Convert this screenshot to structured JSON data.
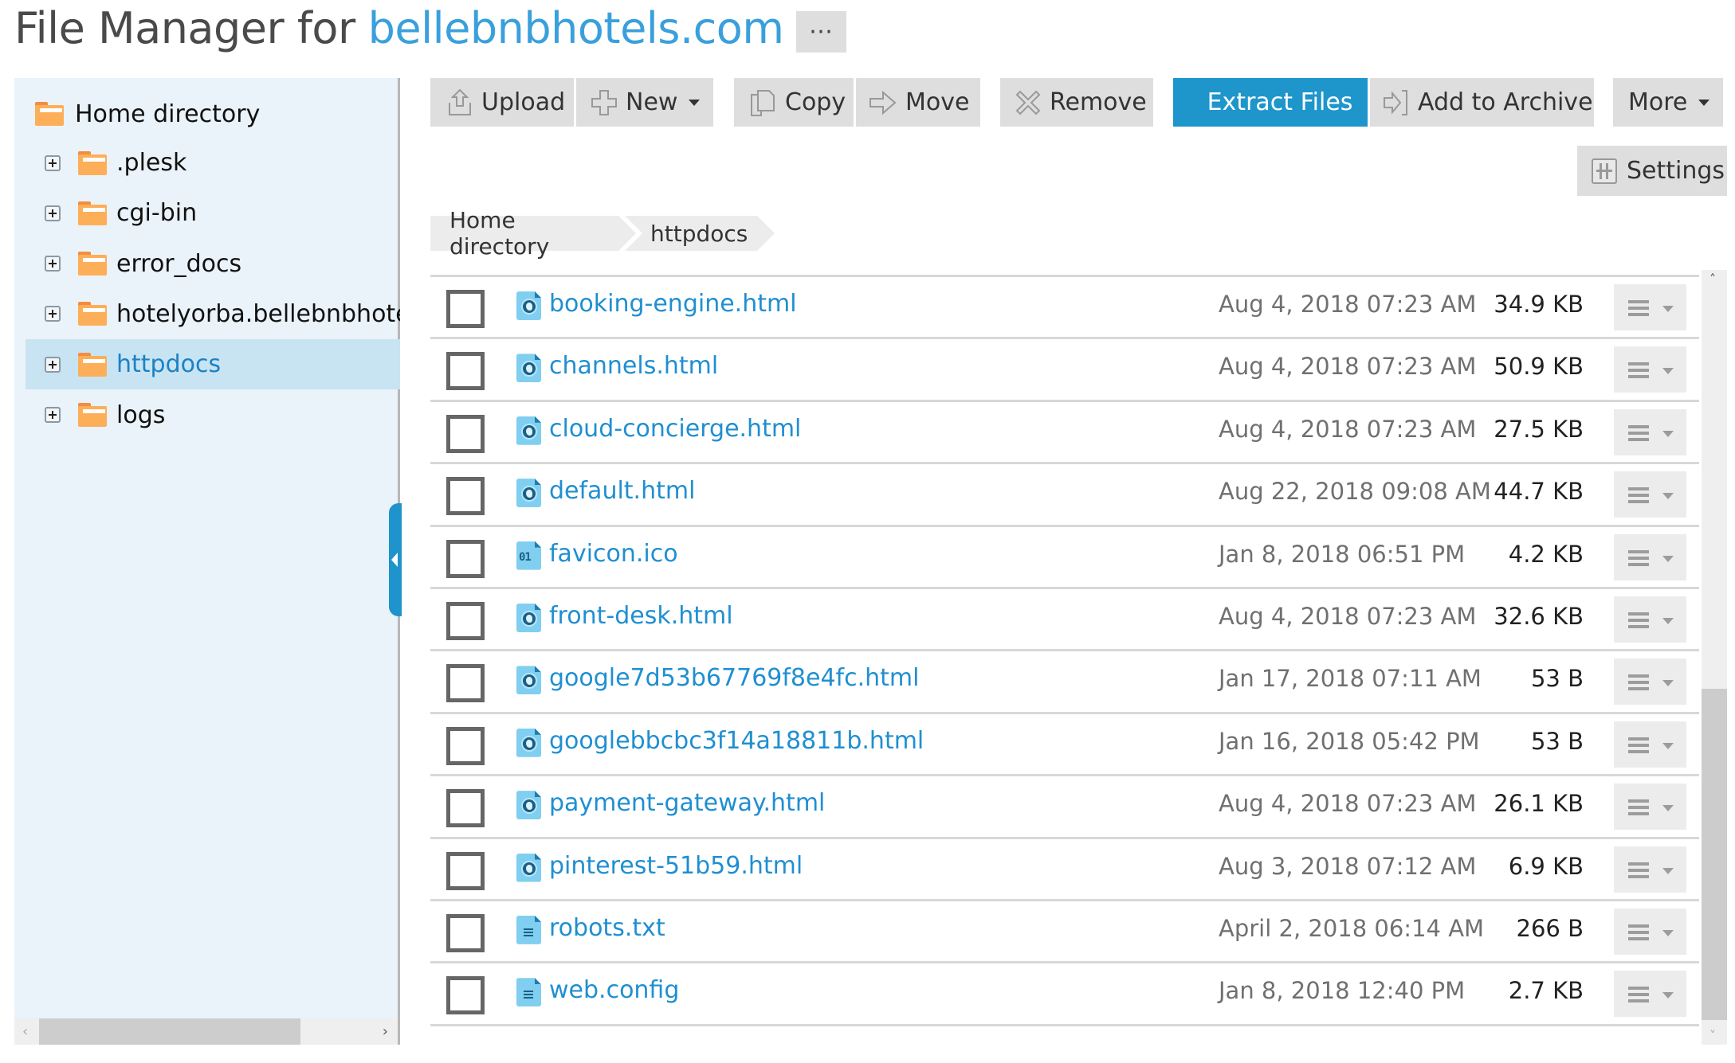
{
  "header": {
    "title_prefix": "File Manager for",
    "domain": "bellebnbhotels.com",
    "more_label": "⋯"
  },
  "sidebar": {
    "root": {
      "label": "Home directory",
      "icon": "folder-icon"
    },
    "items": [
      {
        "label": ".plesk",
        "icon": "folder-icon",
        "selected": false
      },
      {
        "label": "cgi-bin",
        "icon": "folder-icon",
        "selected": false
      },
      {
        "label": "error_docs",
        "icon": "folder-icon",
        "selected": false
      },
      {
        "label": "hotelyorba.bellebnbhotels.com",
        "icon": "folder-icon",
        "selected": false
      },
      {
        "label": "httpdocs",
        "icon": "folder-icon",
        "selected": true
      },
      {
        "label": "logs",
        "icon": "folder-icon",
        "selected": false
      }
    ],
    "scroll_left": "‹",
    "scroll_right": "›"
  },
  "toolbar": {
    "upload": {
      "label": "Upload",
      "icon": "upload-icon"
    },
    "new": {
      "label": "New",
      "icon": "plus-icon"
    },
    "copy": {
      "label": "Copy",
      "icon": "copy-icon"
    },
    "move": {
      "label": "Move",
      "icon": "move-arrow-icon"
    },
    "remove": {
      "label": "Remove",
      "icon": "x-icon"
    },
    "extract": {
      "label": "Extract Files"
    },
    "archive": {
      "label": "Add to Archive",
      "icon": "archive-icon"
    },
    "more": {
      "label": "More"
    },
    "settings": {
      "label": "Settings",
      "icon": "settings-sliders-icon"
    },
    "accent_color": "#1e96cc"
  },
  "breadcrumb": [
    "Home directory",
    "httpdocs"
  ],
  "files": [
    {
      "name": "booking-engine.html",
      "type": "html",
      "modified": "Aug 4, 2018 07:23 AM",
      "size": "34.9 KB"
    },
    {
      "name": "channels.html",
      "type": "html",
      "modified": "Aug 4, 2018 07:23 AM",
      "size": "50.9 KB"
    },
    {
      "name": "cloud-concierge.html",
      "type": "html",
      "modified": "Aug 4, 2018 07:23 AM",
      "size": "27.5 KB"
    },
    {
      "name": "default.html",
      "type": "html",
      "modified": "Aug 22, 2018 09:08 AM",
      "size": "44.7 KB"
    },
    {
      "name": "favicon.ico",
      "type": "bin",
      "icon_text": "01",
      "modified": "Jan 8, 2018 06:51 PM",
      "size": "4.2 KB"
    },
    {
      "name": "front-desk.html",
      "type": "html",
      "modified": "Aug 4, 2018 07:23 AM",
      "size": "32.6 KB"
    },
    {
      "name": "google7d53b67769f8e4fc.html",
      "type": "html",
      "modified": "Jan 17, 2018 07:11 AM",
      "size": "53 B"
    },
    {
      "name": "googlebbcbc3f14a18811b.html",
      "type": "html",
      "modified": "Jan 16, 2018 05:42 PM",
      "size": "53 B"
    },
    {
      "name": "payment-gateway.html",
      "type": "html",
      "modified": "Aug 4, 2018 07:23 AM",
      "size": "26.1 KB"
    },
    {
      "name": "pinterest-51b59.html",
      "type": "html",
      "modified": "Aug 3, 2018 07:12 AM",
      "size": "6.9 KB"
    },
    {
      "name": "robots.txt",
      "type": "txt",
      "modified": "April 2, 2018 06:14 AM",
      "size": "266 B"
    },
    {
      "name": "web.config",
      "type": "txt",
      "modified": "Jan 8, 2018 12:40 PM",
      "size": "2.7 KB"
    }
  ],
  "scrollbar": {
    "up": "˄",
    "down": "˅"
  }
}
